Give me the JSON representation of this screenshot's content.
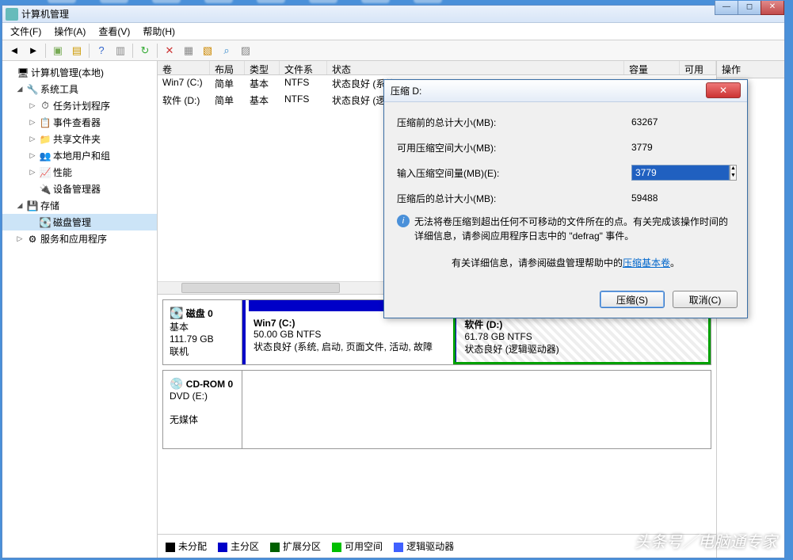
{
  "window": {
    "title": "计算机管理"
  },
  "menu": {
    "file": "文件(F)",
    "action": "操作(A)",
    "view": "查看(V)",
    "help": "帮助(H)"
  },
  "tree": {
    "root": "计算机管理(本地)",
    "sys_tools": "系统工具",
    "task_sched": "任务计划程序",
    "event_viewer": "事件查看器",
    "shared": "共享文件夹",
    "local_users": "本地用户和组",
    "perf": "性能",
    "dev_mgr": "设备管理器",
    "storage": "存储",
    "disk_mgmt": "磁盘管理",
    "services": "服务和应用程序"
  },
  "vol_header": {
    "vol": "卷",
    "layout": "布局",
    "type": "类型",
    "fs": "文件系统",
    "status": "状态",
    "cap": "容量",
    "free": "可用"
  },
  "volumes": [
    {
      "name": "Win7 (C:)",
      "layout": "简单",
      "type": "基本",
      "fs": "NTFS",
      "status": "状态良好 (系统"
    },
    {
      "name": "软件 (D:)",
      "layout": "简单",
      "type": "基本",
      "fs": "NTFS",
      "status": "状态良好 (逻辑"
    }
  ],
  "disks": {
    "disk0": {
      "title": "磁盘 0",
      "type": "基本",
      "size": "111.79 GB",
      "state": "联机"
    },
    "partC": {
      "name": "Win7  (C:)",
      "size": "50.00 GB NTFS",
      "status": "状态良好 (系统, 启动, 页面文件, 活动, 故障"
    },
    "partD": {
      "name": "软件  (D:)",
      "size": "61.78 GB NTFS",
      "status": "状态良好 (逻辑驱动器)"
    },
    "cdrom": {
      "title": "CD-ROM 0",
      "type": "DVD (E:)",
      "state": "无媒体"
    }
  },
  "legend": {
    "unalloc": "未分配",
    "primary": "主分区",
    "ext": "扩展分区",
    "free": "可用空间",
    "logical": "逻辑驱动器"
  },
  "right_pane": {
    "header": "操作"
  },
  "dialog": {
    "title": "压缩 D:",
    "before_label": "压缩前的总计大小(MB):",
    "before_val": "63267",
    "avail_label": "可用压缩空间大小(MB):",
    "avail_val": "3779",
    "input_label": "输入压缩空间量(MB)(E):",
    "input_val": "3779",
    "after_label": "压缩后的总计大小(MB):",
    "after_val": "59488",
    "info1": "无法将卷压缩到超出任何不可移动的文件所在的点。有关完成该操作时间的详细信息，请参阅应用程序日志中的 \"defrag\" 事件。",
    "info2_pre": "有关详细信息，请参阅磁盘管理帮助中的",
    "info2_link": "压缩基本卷",
    "info2_post": "。",
    "ok": "压缩(S)",
    "cancel": "取消(C)"
  },
  "watermark": "头条号／电脑通专家"
}
